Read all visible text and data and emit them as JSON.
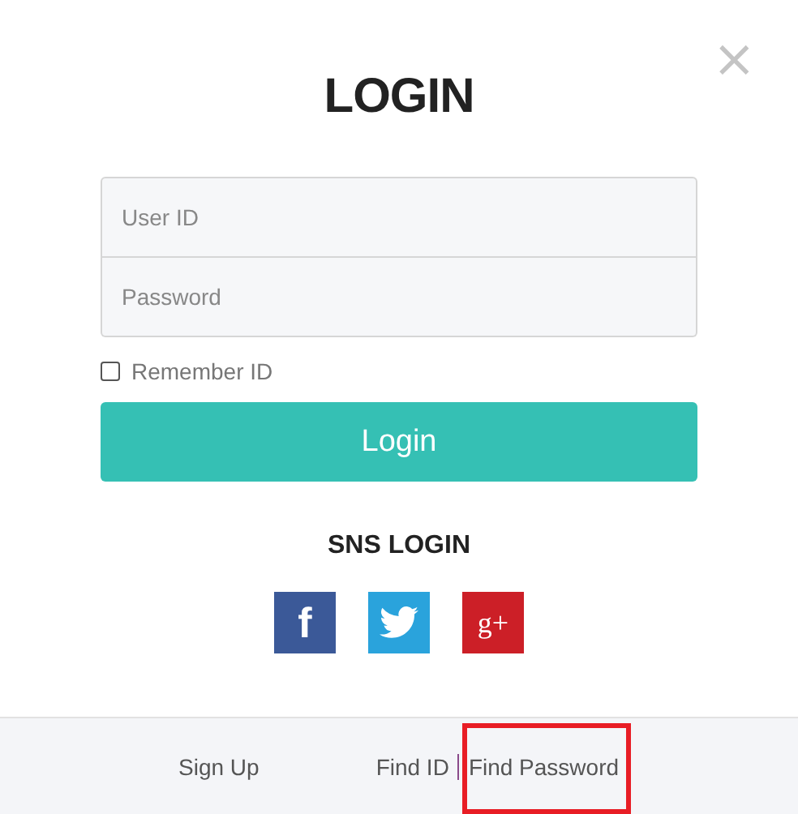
{
  "close": "×",
  "title": "LOGIN",
  "fields": [
    {
      "placeholder": "User ID"
    },
    {
      "placeholder": "Password"
    }
  ],
  "remember": {
    "label": "Remember ID",
    "checked": false
  },
  "login_button": "Login",
  "sns": {
    "title": "SNS LOGIN",
    "buttons": [
      {
        "kind": "facebook",
        "glyph": "f",
        "color": "#3b5998"
      },
      {
        "kind": "twitter",
        "color": "#2aa3dc"
      },
      {
        "kind": "google",
        "glyph": "g+",
        "color": "#cc1f27"
      }
    ]
  },
  "footer": [
    {
      "kind": "link",
      "label": "Sign Up",
      "highlighted": false
    },
    {
      "kind": "link",
      "label": "Find ID",
      "highlighted": false
    },
    {
      "kind": "separator"
    },
    {
      "kind": "link",
      "label": "Find Password",
      "highlighted": true
    }
  ]
}
